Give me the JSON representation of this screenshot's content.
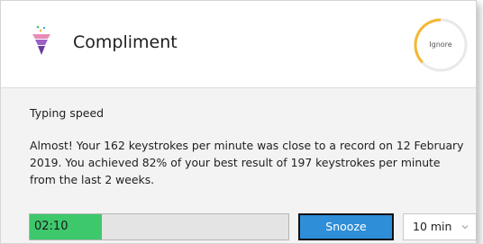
{
  "header": {
    "title": "Compliment",
    "app_icon": "funnel-icon",
    "ignore_label": "Ignore",
    "ignore_ring_color": "#f5b731"
  },
  "body": {
    "section_title": "Typing speed",
    "message": "Almost! Your 162 keystrokes per minute was close to a record on 12 February 2019. You achieved 82% of your best result of 197 keystrokes per minute from the last 2 weeks."
  },
  "footer": {
    "progress_text": "02:10",
    "progress_fraction": 0.28,
    "progress_color": "#3ec86c",
    "snooze_label": "Snooze",
    "snooze_color": "#2f8ed8",
    "duration_value": "10 min"
  }
}
